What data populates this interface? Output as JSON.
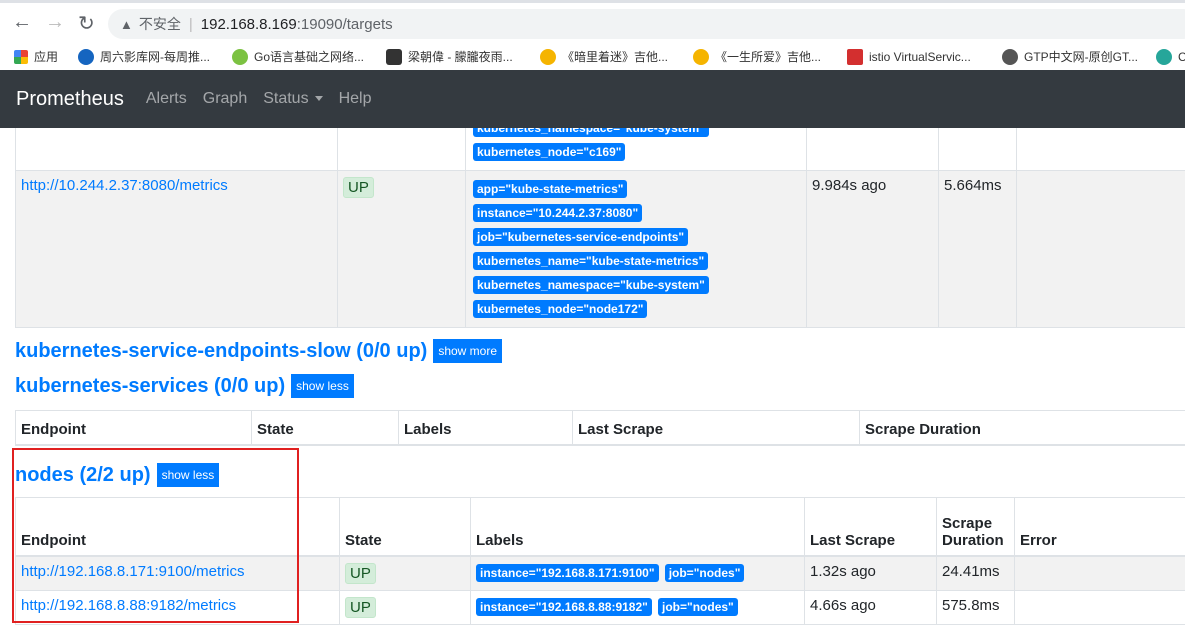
{
  "browser": {
    "url_insecure": "不安全",
    "url_host": "192.168.8.169",
    "url_rest": ":19090/targets",
    "bookmarks": [
      "应用",
      "周六影库网-每周推...",
      "Go语言基础之网络...",
      "梁朝偉 - 朦朧夜雨...",
      "《暗里着迷》吉他...",
      "《一生所爱》吉他...",
      "istio VirtualServic...",
      "GTP中文网-原创GT...",
      "C"
    ]
  },
  "navbar": {
    "brand": "Prometheus",
    "links": [
      "Alerts",
      "Graph",
      "Status",
      "Help"
    ]
  },
  "top_table": {
    "partial_labels": [
      "kubernetes_namespace=\"kube-system\"",
      "kubernetes_node=\"c169\""
    ],
    "row": {
      "endpoint": "http://10.244.2.37:8080/metrics",
      "state": "UP",
      "labels": [
        "app=\"kube-state-metrics\"",
        "instance=\"10.244.2.37:8080\"",
        "job=\"kubernetes-service-endpoints\"",
        "kubernetes_name=\"kube-state-metrics\"",
        "kubernetes_namespace=\"kube-system\"",
        "kubernetes_node=\"node172\""
      ],
      "last_scrape": "9.984s ago",
      "duration": "5.664ms"
    }
  },
  "groups": [
    {
      "title": "kubernetes-service-endpoints-slow (0/0 up)",
      "button": "show more"
    },
    {
      "title": "kubernetes-services (0/0 up)",
      "button": "show less"
    },
    {
      "title": "nodes (2/2 up)",
      "button": "show less"
    }
  ],
  "services_headers": [
    "Endpoint",
    "State",
    "Labels",
    "Last Scrape",
    "Scrape Duration"
  ],
  "nodes_headers": [
    "Endpoint",
    "State",
    "Labels",
    "Last Scrape",
    "Scrape Duration",
    "Error"
  ],
  "nodes_rows": [
    {
      "endpoint": "http://192.168.8.171:9100/metrics",
      "state": "UP",
      "labels": [
        "instance=\"192.168.8.171:9100\"",
        "job=\"nodes\""
      ],
      "last_scrape": "1.32s ago",
      "duration": "24.41ms"
    },
    {
      "endpoint": "http://192.168.8.88:9182/metrics",
      "state": "UP",
      "labels": [
        "instance=\"192.168.8.88:9182\"",
        "job=\"nodes\""
      ],
      "last_scrape": "4.66s ago",
      "duration": "575.8ms"
    }
  ]
}
